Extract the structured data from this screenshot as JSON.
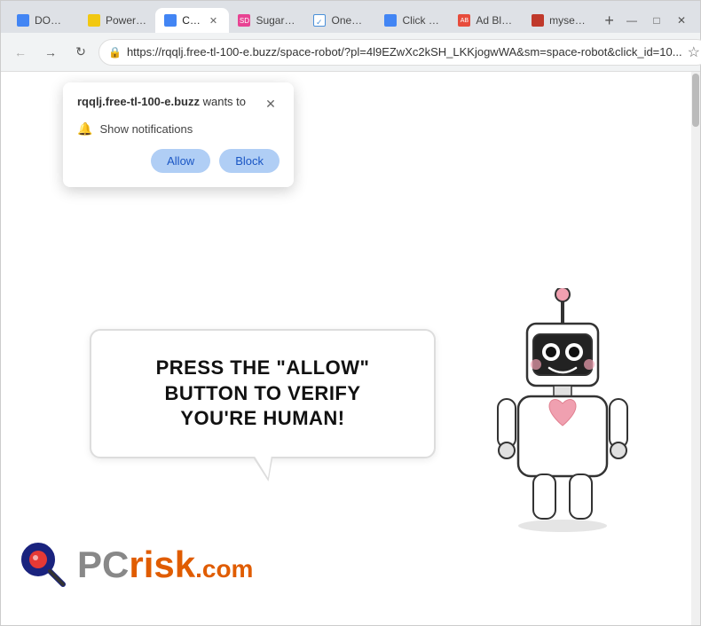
{
  "browser": {
    "title": "Click",
    "tabs": [
      {
        "id": "tab-dl",
        "label": "DOWN...",
        "favicon_color": "#4285f4",
        "active": false
      },
      {
        "id": "tab-pbi",
        "label": "Power B...",
        "favicon_color": "#f2c811",
        "active": false
      },
      {
        "id": "tab-cl",
        "label": "Clic...",
        "favicon_color": "#4285f4",
        "active": true
      },
      {
        "id": "tab-sd",
        "label": "Sugar D...",
        "favicon_color": "#e84393",
        "active": false
      },
      {
        "id": "tab-ot",
        "label": "OneTa...",
        "favicon_color": "#4a90d9",
        "active": false
      },
      {
        "id": "tab-cl2",
        "label": "Click \"A...",
        "favicon_color": "#4285f4",
        "active": false
      },
      {
        "id": "tab-ab",
        "label": "Ad Bloc...",
        "favicon_color": "#e74c3c",
        "active": false
      },
      {
        "id": "tab-ms",
        "label": "mysexy...",
        "favicon_color": "#c0392b",
        "active": false
      }
    ],
    "url": "https://rqqlj.free-tl-100-e.buzz/space-robot/?pl=4l9EZwXc2kSH_LKKjogwWA&sm=space-robot&click_id=10...",
    "window_buttons": {
      "minimize": "—",
      "maximize": "□",
      "close": "✕"
    }
  },
  "notification_popup": {
    "domain": "rqqlj.free-tl-100-e.buzz",
    "wants_to": "wants to",
    "notification_label": "Show notifications",
    "allow_label": "Allow",
    "block_label": "Block"
  },
  "page": {
    "speech_bubble_text": "PRESS THE \"ALLOW\" BUTTON TO VERIFY\nYOU'RE HUMAN!",
    "pcrisk_text": "PC",
    "pcrisk_risk": "risk",
    "pcrisk_com": ".com"
  }
}
